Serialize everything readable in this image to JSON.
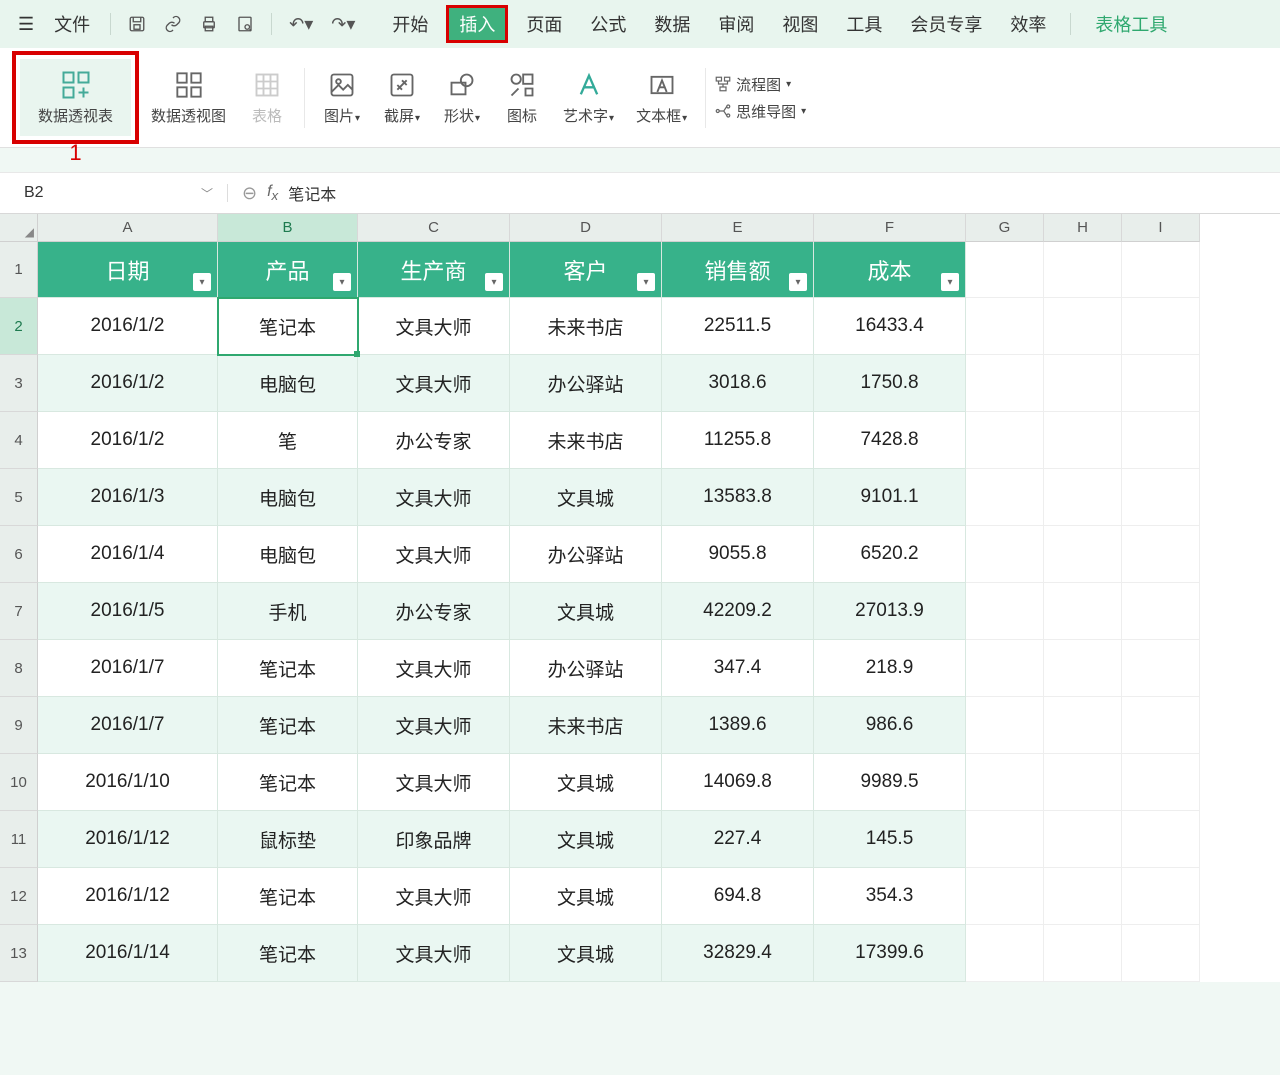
{
  "menubar": {
    "file": "文件",
    "tabs": [
      "开始",
      "插入",
      "页面",
      "公式",
      "数据",
      "审阅",
      "视图",
      "工具",
      "会员专享",
      "效率"
    ],
    "table_tools": "表格工具",
    "active_tab_index": 1
  },
  "ribbon": {
    "pivot_table": "数据透视表",
    "pivot_chart": "数据透视图",
    "table": "表格",
    "picture": "图片",
    "screenshot": "截屏",
    "shapes": "形状",
    "icons": "图标",
    "wordart": "艺术字",
    "textbox": "文本框",
    "flowchart": "流程图",
    "mindmap": "思维导图",
    "annotation_num": "1"
  },
  "namebox": "B2",
  "formula_value": "笔记本",
  "columns": [
    "A",
    "B",
    "C",
    "D",
    "E",
    "F",
    "G",
    "H",
    "I"
  ],
  "table": {
    "headers": [
      "日期",
      "产品",
      "生产商",
      "客户",
      "销售额",
      "成本"
    ],
    "rows": [
      [
        "2016/1/2",
        "笔记本",
        "文具大师",
        "未来书店",
        "22511.5",
        "16433.4"
      ],
      [
        "2016/1/2",
        "电脑包",
        "文具大师",
        "办公驿站",
        "3018.6",
        "1750.8"
      ],
      [
        "2016/1/2",
        "笔",
        "办公专家",
        "未来书店",
        "11255.8",
        "7428.8"
      ],
      [
        "2016/1/3",
        "电脑包",
        "文具大师",
        "文具城",
        "13583.8",
        "9101.1"
      ],
      [
        "2016/1/4",
        "电脑包",
        "文具大师",
        "办公驿站",
        "9055.8",
        "6520.2"
      ],
      [
        "2016/1/5",
        "手机",
        "办公专家",
        "文具城",
        "42209.2",
        "27013.9"
      ],
      [
        "2016/1/7",
        "笔记本",
        "文具大师",
        "办公驿站",
        "347.4",
        "218.9"
      ],
      [
        "2016/1/7",
        "笔记本",
        "文具大师",
        "未来书店",
        "1389.6",
        "986.6"
      ],
      [
        "2016/1/10",
        "笔记本",
        "文具大师",
        "文具城",
        "14069.8",
        "9989.5"
      ],
      [
        "2016/1/12",
        "鼠标垫",
        "印象品牌",
        "文具城",
        "227.4",
        "145.5"
      ],
      [
        "2016/1/12",
        "笔记本",
        "文具大师",
        "文具城",
        "694.8",
        "354.3"
      ],
      [
        "2016/1/14",
        "笔记本",
        "文具大师",
        "文具城",
        "32829.4",
        "17399.6"
      ]
    ]
  },
  "selected_cell": {
    "row": 2,
    "col": "B"
  }
}
